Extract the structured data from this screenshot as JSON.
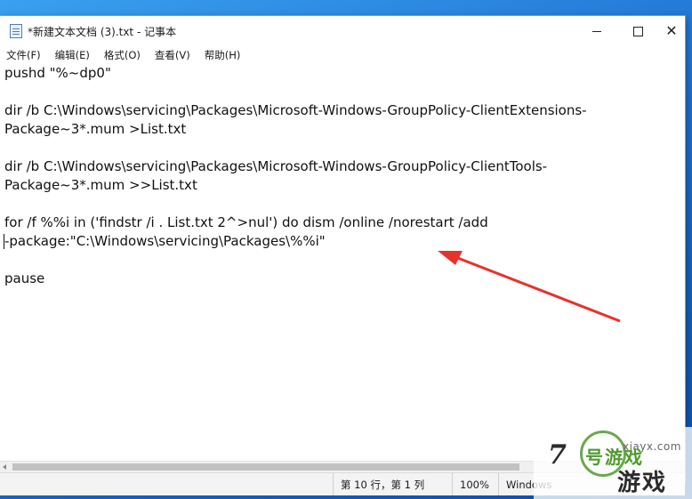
{
  "window": {
    "title": "*新建文本文档 (3).txt - 记事本"
  },
  "controls": {
    "minimize_icon": "minimize-icon",
    "maximize_icon": "maximize-icon",
    "close_glyph": "✕"
  },
  "menu": {
    "items": [
      "文件(F)",
      "编辑(E)",
      "格式(O)",
      "查看(V)",
      "帮助(H)"
    ]
  },
  "editor": {
    "lines": [
      "pushd \"%~dp0\"",
      "",
      "dir /b C:\\Windows\\servicing\\Packages\\Microsoft-Windows-GroupPolicy-ClientExtensions-",
      "Package~3*.mum >List.txt",
      "",
      "dir /b C:\\Windows\\servicing\\Packages\\Microsoft-Windows-GroupPolicy-ClientTools-",
      "Package~3*.mum >>List.txt",
      "",
      "for /f %%i in ('findstr /i . List.txt 2^>nul') do dism /online /norestart /add",
      "-package:\"C:\\Windows\\servicing\\Packages\\%%i\"",
      "",
      "pause"
    ]
  },
  "status": {
    "position": "第 10 行，第 1 列",
    "zoom": "100%",
    "line_ending": "Windows"
  },
  "watermark": {
    "number": "7",
    "site": "xiayx.com",
    "cn_top": "号游戏",
    "cn_big": "游戏"
  },
  "colors": {
    "annotation_arrow": "#e8312a",
    "desktop": "#1f6fc4"
  }
}
